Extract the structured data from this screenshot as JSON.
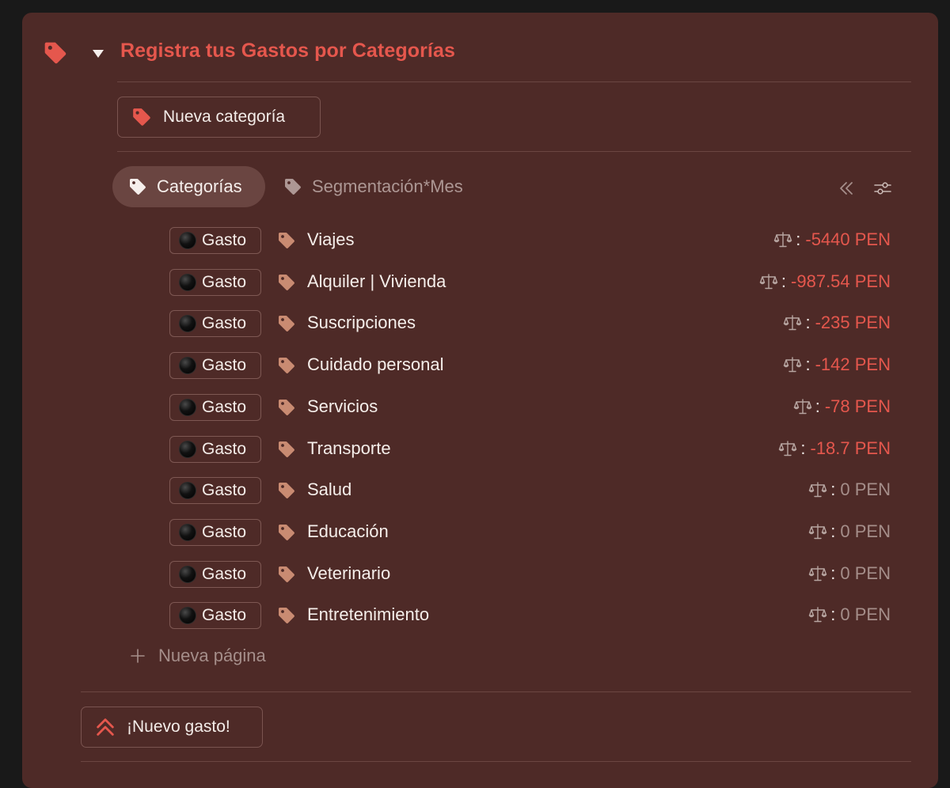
{
  "header": {
    "title": "Registra tus Gastos por Categorías",
    "icon": "tag-icon",
    "accent": "#e5574d"
  },
  "new_category_button": {
    "label": "Nueva categoría",
    "icon": "tag-icon"
  },
  "tabs": [
    {
      "label": "Categorías",
      "icon": "tag-icon",
      "active": true
    },
    {
      "label": "Segmentación*Mes",
      "icon": "tag-icon",
      "active": false
    }
  ],
  "toolbar": {
    "collapse_icon": "double-chevron-left-icon",
    "filter_icon": "sliders-icon"
  },
  "rows": [
    {
      "type": "Gasto",
      "name": "Viajes",
      "value": "-5440 PEN",
      "negative": true
    },
    {
      "type": "Gasto",
      "name": "Alquiler | Vivienda",
      "value": "-987.54 PEN",
      "negative": true
    },
    {
      "type": "Gasto",
      "name": "Suscripciones",
      "value": "-235 PEN",
      "negative": true
    },
    {
      "type": "Gasto",
      "name": "Cuidado personal",
      "value": "-142 PEN",
      "negative": true
    },
    {
      "type": "Gasto",
      "name": "Servicios",
      "value": "-78 PEN",
      "negative": true
    },
    {
      "type": "Gasto",
      "name": "Transporte",
      "value": "-18.7 PEN",
      "negative": true
    },
    {
      "type": "Gasto",
      "name": "Salud",
      "value": "0 PEN",
      "negative": false
    },
    {
      "type": "Gasto",
      "name": "Educación",
      "value": "0 PEN",
      "negative": false
    },
    {
      "type": "Gasto",
      "name": "Veterinario",
      "value": "0 PEN",
      "negative": false
    },
    {
      "type": "Gasto",
      "name": "Entretenimiento",
      "value": "0 PEN",
      "negative": false
    }
  ],
  "value_separator": ":",
  "new_page": {
    "label": "Nueva página"
  },
  "new_expense_button": {
    "label": "¡Nuevo gasto!",
    "icon": "double-chevron-up-icon"
  },
  "colors": {
    "negative": "#e5574d",
    "zero": "#a58e8a",
    "row_tag": "#c98b72",
    "panel_bg": "#4e2a27"
  }
}
